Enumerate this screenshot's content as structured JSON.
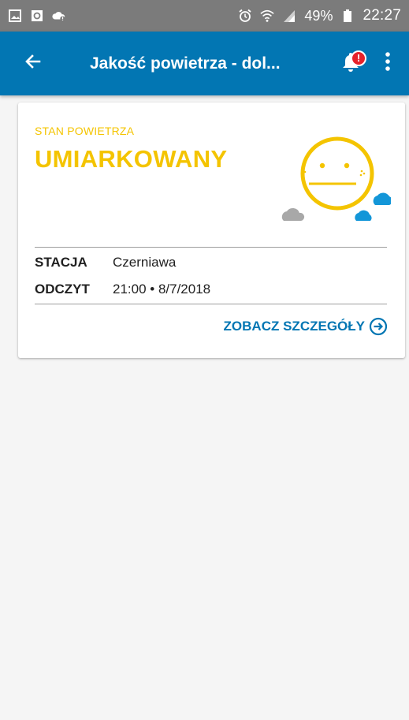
{
  "status_bar": {
    "battery_percent": "49%",
    "time": "22:27",
    "icons": [
      "gallery-icon",
      "app-update-icon",
      "cloud-alert-icon",
      "alarm-icon",
      "wifi-icon",
      "signal-icon",
      "battery-icon"
    ]
  },
  "app_bar": {
    "title": "Jakość powietrza - dol...",
    "notification_badge": "!",
    "color": "#0276b3"
  },
  "card": {
    "label": "STAN POWIETRZA",
    "status": "UMIARKOWANY",
    "status_color": "#f4c400",
    "station_key": "STACJA",
    "station_value": "Czerniawa",
    "reading_key": "ODCZYT",
    "reading_value": "21:00 • 8/7/2018",
    "details_link": "ZOBACZ SZCZEGÓŁY"
  }
}
